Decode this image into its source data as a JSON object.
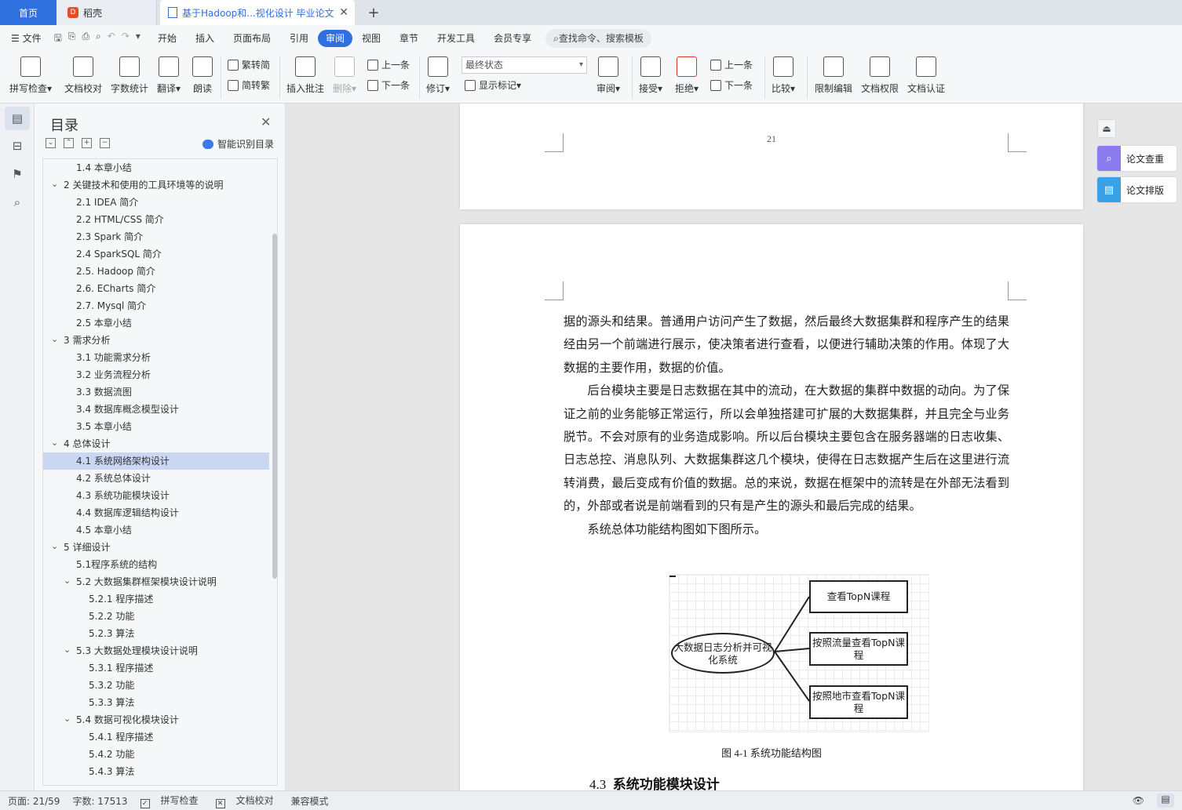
{
  "tabs": {
    "home": "首页",
    "daoke": "稻壳",
    "doc": "基于Hadoop和...视化设计 毕业论文",
    "add": "+"
  },
  "menu": {
    "file": "文件",
    "items": [
      "开始",
      "插入",
      "页面布局",
      "引用",
      "审阅",
      "视图",
      "章节",
      "开发工具",
      "会员专享"
    ],
    "active": "审阅",
    "search": "查找命令、搜索模板"
  },
  "ribbon": {
    "spell_check": "拼写检查",
    "doc_proof": "文档校对",
    "word_count": "字数统计",
    "translate": "翻译",
    "read_aloud": "朗读",
    "to_traditional": "繁转简",
    "to_simplified": "简转繁",
    "insert_comment": "插入批注",
    "delete": "删除",
    "prev1": "上一条",
    "next1": "下一条",
    "track": "修订",
    "final_state": "最终状态",
    "show_marks": "显示标记",
    "review": "审阅",
    "accept": "接受",
    "reject": "拒绝",
    "prev2": "上一条",
    "next2": "下一条",
    "compare": "比较",
    "restrict": "限制编辑",
    "doc_rights": "文档权限",
    "doc_cert": "文档认证"
  },
  "toc": {
    "title": "目录",
    "smart": "智能识别目录",
    "items": [
      {
        "text": "1.4  本章小结",
        "level": 2
      },
      {
        "text": "2   关键技术和使用的工具环境等的说明",
        "level": 1,
        "expand": true
      },
      {
        "text": "2.1 IDEA 简介",
        "level": 2
      },
      {
        "text": "2.2 HTML/CSS 简介",
        "level": 2
      },
      {
        "text": "2.3 Spark 简介",
        "level": 2
      },
      {
        "text": "2.4 SparkSQL 简介",
        "level": 2
      },
      {
        "text": "2.5. Hadoop 简介",
        "level": 2
      },
      {
        "text": "2.6. ECharts 简介",
        "level": 2
      },
      {
        "text": "2.7. Mysql 简介",
        "level": 2
      },
      {
        "text": "2.5  本章小结",
        "level": 2
      },
      {
        "text": "3    需求分析",
        "level": 1,
        "expand": true
      },
      {
        "text": "3.1  功能需求分析",
        "level": 2
      },
      {
        "text": "3.2  业务流程分析",
        "level": 2
      },
      {
        "text": "3.3  数据流图",
        "level": 2
      },
      {
        "text": "3.4  数据库概念模型设计",
        "level": 2
      },
      {
        "text": "3.5  本章小结",
        "level": 2
      },
      {
        "text": "4    总体设计",
        "level": 1,
        "expand": true
      },
      {
        "text": "4.1  系统网络架构设计",
        "level": 2,
        "selected": true
      },
      {
        "text": "4.2  系统总体设计",
        "level": 2
      },
      {
        "text": "4.3  系统功能模块设计",
        "level": 2
      },
      {
        "text": "4.4  数据库逻辑结构设计",
        "level": 2
      },
      {
        "text": "4.5  本章小结",
        "level": 2
      },
      {
        "text": "5    详细设计",
        "level": 1,
        "expand": true
      },
      {
        "text": "5.1程序系统的结构",
        "level": 2
      },
      {
        "text": "5.2    大数据集群框架模块设计说明",
        "level": 2,
        "expand": true
      },
      {
        "text": "5.2.1  程序描述",
        "level": 3
      },
      {
        "text": "5.2.2  功能",
        "level": 3
      },
      {
        "text": "5.2.3  算法",
        "level": 3
      },
      {
        "text": "5.3    大数据处理模块设计说明",
        "level": 2,
        "expand": true
      },
      {
        "text": "5.3.1  程序描述",
        "level": 3
      },
      {
        "text": "5.3.2  功能",
        "level": 3
      },
      {
        "text": "5.3.3  算法",
        "level": 3
      },
      {
        "text": "5.4    数据可视化模块设计",
        "level": 2,
        "expand": true
      },
      {
        "text": "5.4.1  程序描述",
        "level": 3
      },
      {
        "text": "5.4.2  功能",
        "level": 3
      },
      {
        "text": "5.4.3  算法",
        "level": 3
      }
    ]
  },
  "document": {
    "page_number": "21",
    "paragraphs": [
      {
        "text": "据的源头和结果。普通用户访问产生了数据，然后最终大数据集群和程序产生的结果经由另一个前端进行展示，使决策者进行查看，以便进行辅助决策的作用。体现了大数据的主要作用，数据的价值。",
        "indent": false
      },
      {
        "text": "后台模块主要是日志数据在其中的流动，在大数据的集群中数据的动向。为了保证之前的业务能够正常运行，所以会单独搭建可扩展的大数据集群，并且完全与业务脱节。不会对原有的业务造成影响。所以后台模块主要包含在服务器端的日志收集、日志总控、消息队列、大数据集群这几个模块，使得在日志数据产生后在这里进行流转消费，最后变成有价值的数据。总的来说，数据在框架中的流转是在外部无法看到的，外部或者说是前端看到的只有是产生的源头和最后完成的结果。",
        "indent": true
      },
      {
        "text": "系统总体功能结构图如下图所示。",
        "indent": true
      }
    ],
    "figure": {
      "center": "大数据日志分析并可视化系统",
      "boxes": [
        "查看TopN课程",
        "按照流量查看TopN课程",
        "按照地市查看TopN课程"
      ]
    },
    "caption": "图 4-1 系统功能结构图",
    "heading_num": "4.3",
    "heading_text": "系统功能模块设计"
  },
  "right_panel": {
    "check": "论文查重",
    "layout": "论文排版"
  },
  "status": {
    "page": "页面: 21/59",
    "words": "字数: 17513",
    "spell": "拼写检查",
    "proof": "文档校对",
    "compat": "兼容模式"
  }
}
